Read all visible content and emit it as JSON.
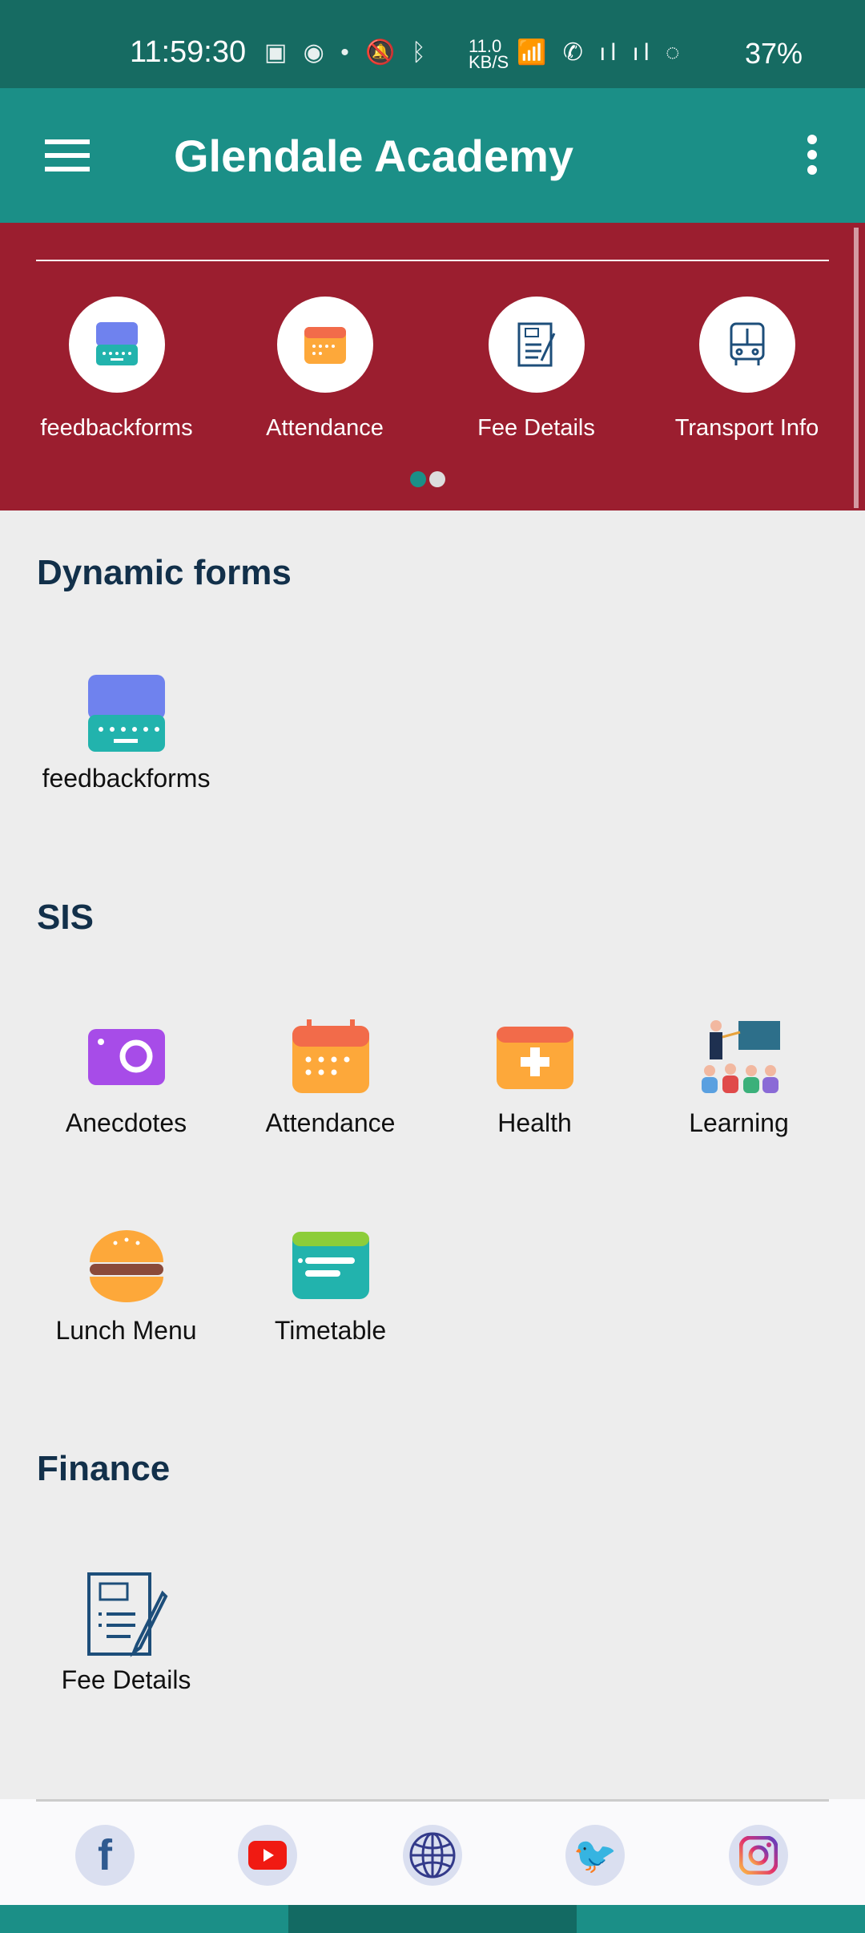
{
  "status_bar": {
    "time": "11:59:30",
    "net_speed": "11.0 KB/S",
    "battery": "37%"
  },
  "app_bar": {
    "title": "Glendale Academy"
  },
  "banner": {
    "items": [
      {
        "label": "feedbackforms",
        "icon": "keyboard-icon"
      },
      {
        "label": "Attendance",
        "icon": "calendar-icon"
      },
      {
        "label": "Fee Details",
        "icon": "fee-document-icon"
      },
      {
        "label": "Transport Info",
        "icon": "bus-icon"
      }
    ],
    "page": 1,
    "pages": 2
  },
  "sections": {
    "dynamic": {
      "title": "Dynamic forms",
      "items": [
        {
          "label": "feedbackforms"
        }
      ]
    },
    "sis": {
      "title": "SIS",
      "items": [
        {
          "label": "Anecdotes"
        },
        {
          "label": "Attendance"
        },
        {
          "label": "Health"
        },
        {
          "label": "Learning"
        },
        {
          "label": "Lunch Menu"
        },
        {
          "label": "Timetable"
        }
      ]
    },
    "finance": {
      "title": "Finance",
      "items": [
        {
          "label": "Fee Details"
        }
      ]
    }
  },
  "footer": {
    "social": [
      "facebook-icon",
      "youtube-icon",
      "globe-icon",
      "twitter-icon",
      "instagram-icon"
    ]
  },
  "colors": {
    "status": "#166b62",
    "appbar": "#1b8f87",
    "banner": "#9b1e2f",
    "heading": "#12304a"
  }
}
